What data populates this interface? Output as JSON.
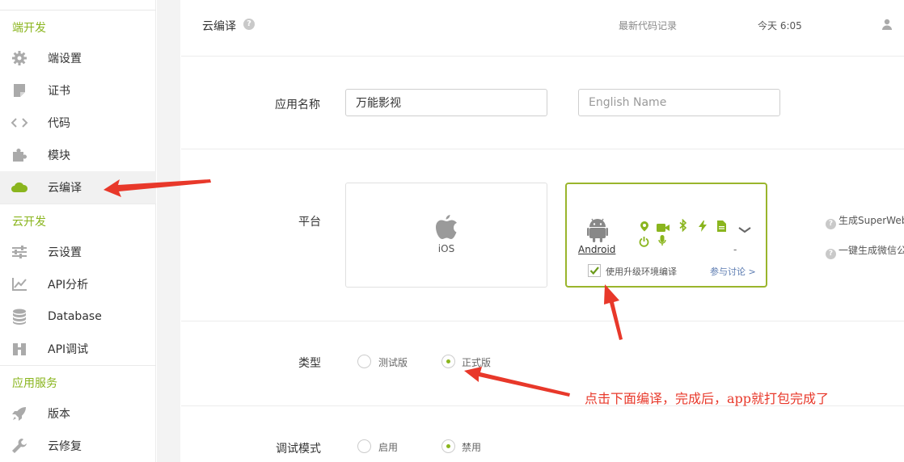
{
  "sidebar": {
    "sections": [
      {
        "title": "端开发"
      },
      {
        "title": "云开发"
      },
      {
        "title": "应用服务"
      }
    ],
    "items": [
      {
        "label": "端设置",
        "icon": "gear-icon"
      },
      {
        "label": "证书",
        "icon": "certificate-icon"
      },
      {
        "label": "代码",
        "icon": "code-icon"
      },
      {
        "label": "模块",
        "icon": "puzzle-icon"
      },
      {
        "label": "云编译",
        "icon": "cloud-icon",
        "active": true
      },
      {
        "label": "云设置",
        "icon": "sliders-icon"
      },
      {
        "label": "API分析",
        "icon": "chart-icon"
      },
      {
        "label": "Database",
        "icon": "database-icon"
      },
      {
        "label": "API调试",
        "icon": "debug-icon"
      },
      {
        "label": "版本",
        "icon": "rocket-icon"
      },
      {
        "label": "云修复",
        "icon": "wrench-icon"
      }
    ]
  },
  "header": {
    "title": "云编译",
    "latest_code_link": "最新代码记录",
    "time": "今天 6:05"
  },
  "form": {
    "app_name": {
      "label": "应用名称",
      "value": "万能影视",
      "english_placeholder": "English Name"
    },
    "platform": {
      "label": "平台",
      "ios_label": "iOS",
      "android_label": "Android",
      "android_version": "-",
      "upgrade_env_label": "使用升级环境编译",
      "upgrade_env_checked": true,
      "discuss_link": "参与讨论 >",
      "side_notes": [
        "生成SuperWeb",
        "一键生成微信公"
      ]
    },
    "type": {
      "label": "类型",
      "options": [
        "测试版",
        "正式版"
      ],
      "selected": "正式版"
    },
    "debug_mode": {
      "label": "调试模式",
      "options": [
        "启用",
        "禁用"
      ],
      "selected": "禁用"
    }
  },
  "annotation": {
    "text": "点击下面编译，完成后，app就打包完成了"
  },
  "colors": {
    "accent": "#8ab51e",
    "selected_border": "#9ab52c",
    "annotation": "#e8382a"
  }
}
